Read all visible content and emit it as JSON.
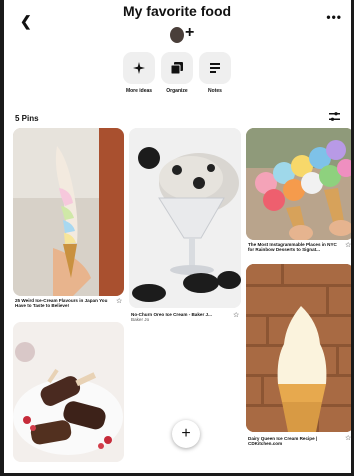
{
  "header": {
    "back_icon": "chevron-left-icon",
    "title": "My favorite food",
    "more_label": "•••"
  },
  "collaborators": {
    "add_label": "+"
  },
  "actions": [
    {
      "label": "More ideas",
      "icon": "sparkle-icon"
    },
    {
      "label": "Organize",
      "icon": "organize-icon"
    },
    {
      "label": "Notes",
      "icon": "notes-icon"
    }
  ],
  "pins": {
    "count_label": "5 Pins",
    "filter_icon": "filter-icon",
    "items": [
      {
        "title": "25 Weird Ice-Cream Flavours in Japan You Have to Taste to Believe!",
        "source": ""
      },
      {
        "title": "No-Churn Oreo Ice Cream - Baker J...",
        "source": "Baker Jo"
      },
      {
        "title": "The Most Instagrammable Places in NYC for Rainbow Desserts to Signat...",
        "source": ""
      },
      {
        "title": "Dairy Queen Ice Cream Recipe | CDKitchen.com",
        "source": ""
      },
      {
        "title": "",
        "source": ""
      }
    ]
  },
  "fab_label": "+"
}
